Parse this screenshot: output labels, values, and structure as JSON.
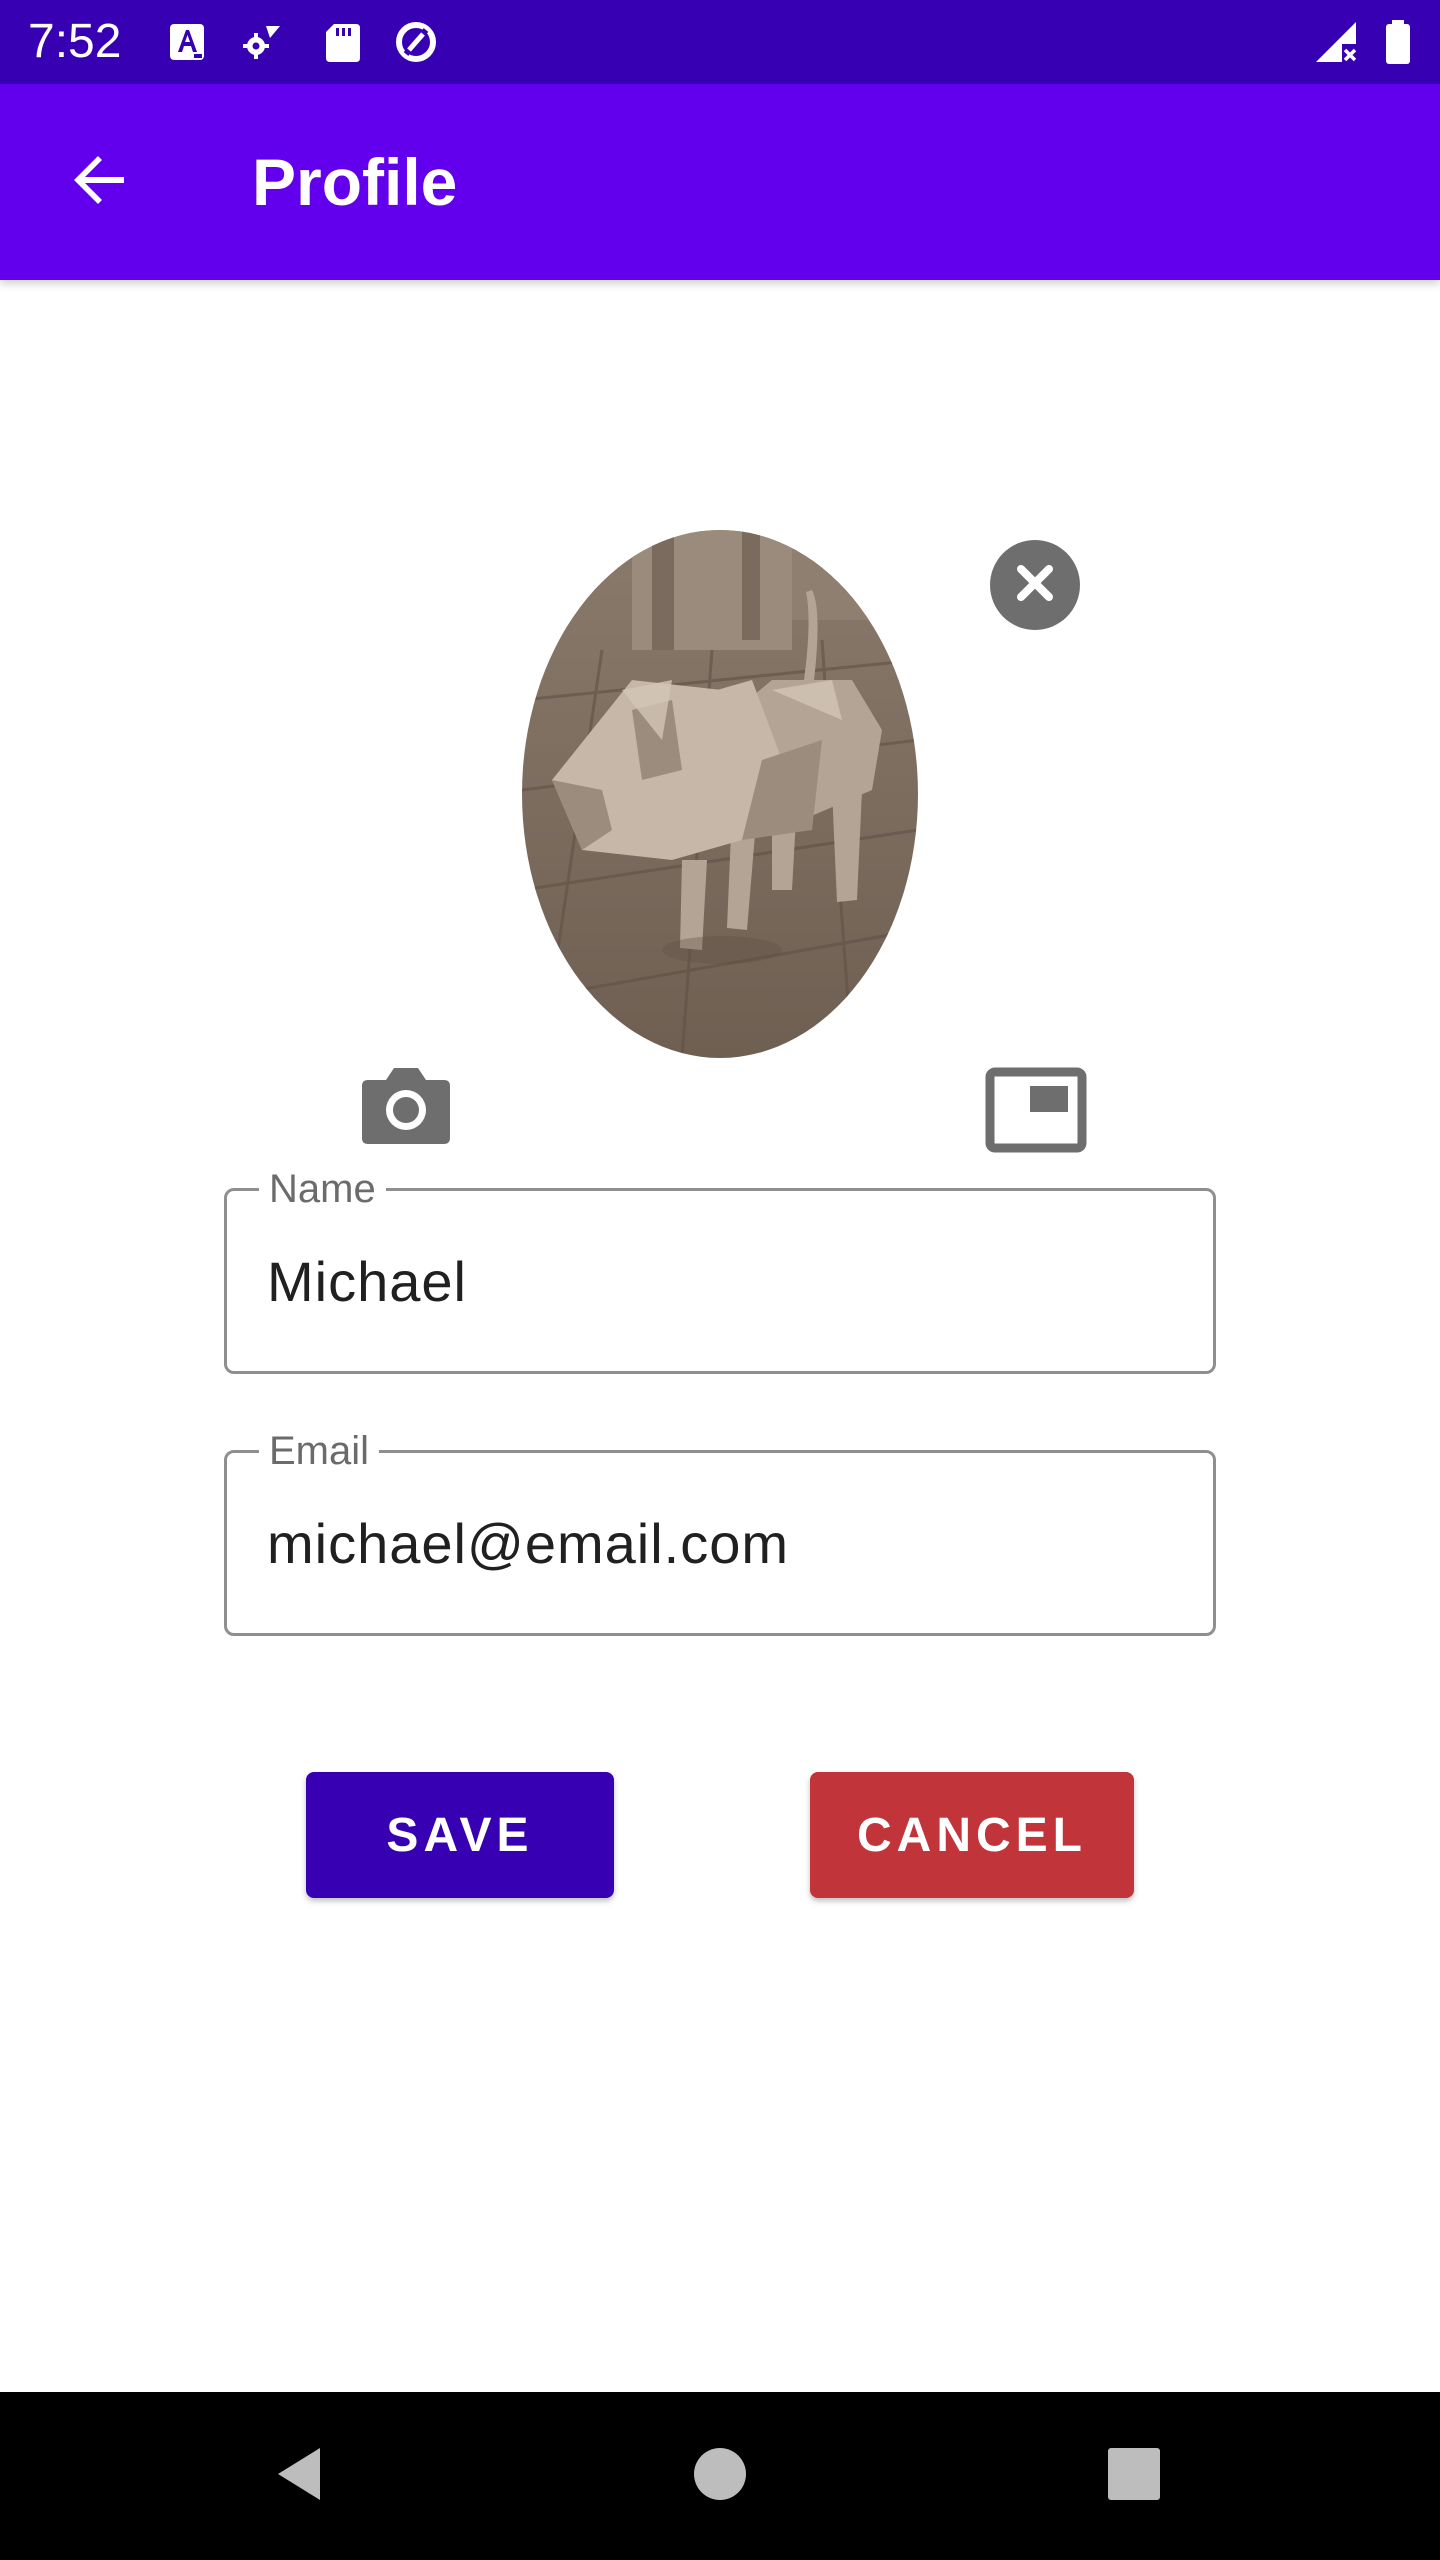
{
  "status_bar": {
    "time": "7:52",
    "icons": [
      "text-a-notification-icon",
      "settings-notification-icon",
      "sd-card-icon",
      "data-saver-icon",
      "signal-no-data-icon",
      "battery-full-icon"
    ]
  },
  "app_bar": {
    "title": "Profile",
    "back_icon": "arrow-back-icon"
  },
  "profile_photo": {
    "remove_icon": "close-circle-icon",
    "camera_icon": "camera-icon",
    "gallery_icon": "gallery-icon"
  },
  "form": {
    "name": {
      "label": "Name",
      "value": "Michael"
    },
    "email": {
      "label": "Email",
      "value": "michael@email.com"
    }
  },
  "actions": {
    "save_label": "SAVE",
    "cancel_label": "CANCEL"
  },
  "colors": {
    "status_bar": "#3700b3",
    "app_bar": "#6200ee",
    "save": "#3700b3",
    "cancel": "#c0343a"
  },
  "nav_bar": {
    "icons": [
      "nav-back-icon",
      "nav-home-icon",
      "nav-recents-icon"
    ]
  }
}
